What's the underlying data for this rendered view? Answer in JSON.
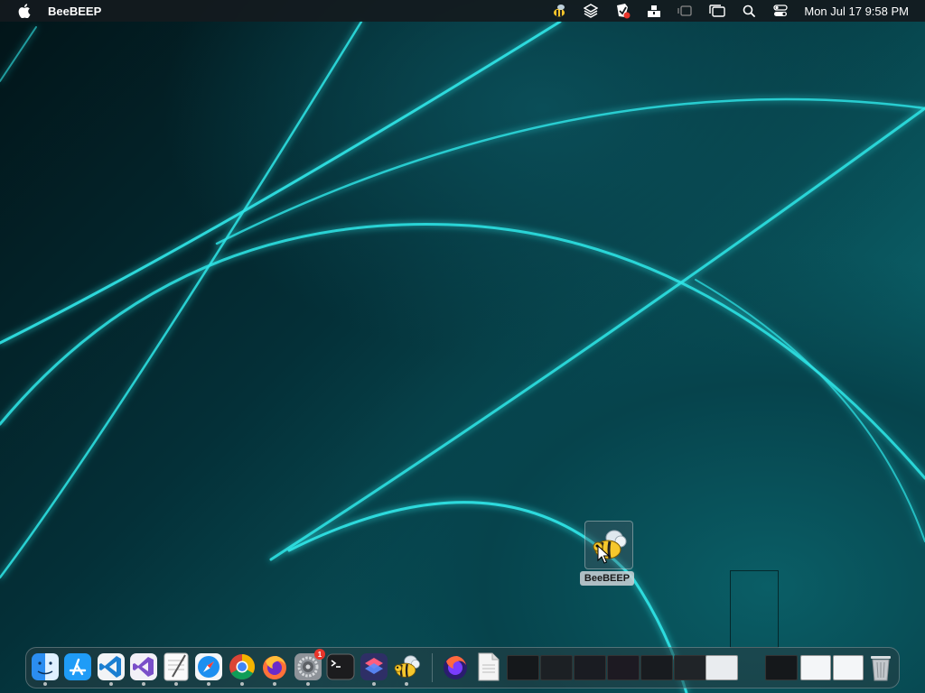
{
  "menubar": {
    "app_name": "BeeBEEP",
    "clock": "Mon Jul 17  9:58 PM",
    "status_icons": [
      "beebeep-icon",
      "layers-icon",
      "shield-badge-icon",
      "stack-icon",
      "screen-icon",
      "window-icon",
      "search-icon",
      "control-center-icon"
    ]
  },
  "desktop": {
    "icon_label": "BeeBEEP"
  },
  "dock": {
    "apps": [
      {
        "name": "finder-icon",
        "running": true
      },
      {
        "name": "app-store-icon",
        "running": false
      },
      {
        "name": "vscode-icon",
        "running": true
      },
      {
        "name": "visual-studio-icon",
        "running": true
      },
      {
        "name": "textedit-icon",
        "running": true
      },
      {
        "name": "safari-icon",
        "running": true
      },
      {
        "name": "chrome-icon",
        "running": true
      },
      {
        "name": "firefox-icon",
        "running": true
      },
      {
        "name": "system-settings-icon",
        "running": true,
        "badge": "1"
      },
      {
        "name": "terminal-icon",
        "running": false
      },
      {
        "name": "shortcuts-icon",
        "running": true
      },
      {
        "name": "beebeep-icon",
        "running": true
      }
    ],
    "recents": [
      "firefox-nightly-icon",
      "document-icon"
    ]
  },
  "colors": {
    "glow": "#2fe6e8",
    "menubar": "#141a1e",
    "badge": "#e8352b"
  }
}
